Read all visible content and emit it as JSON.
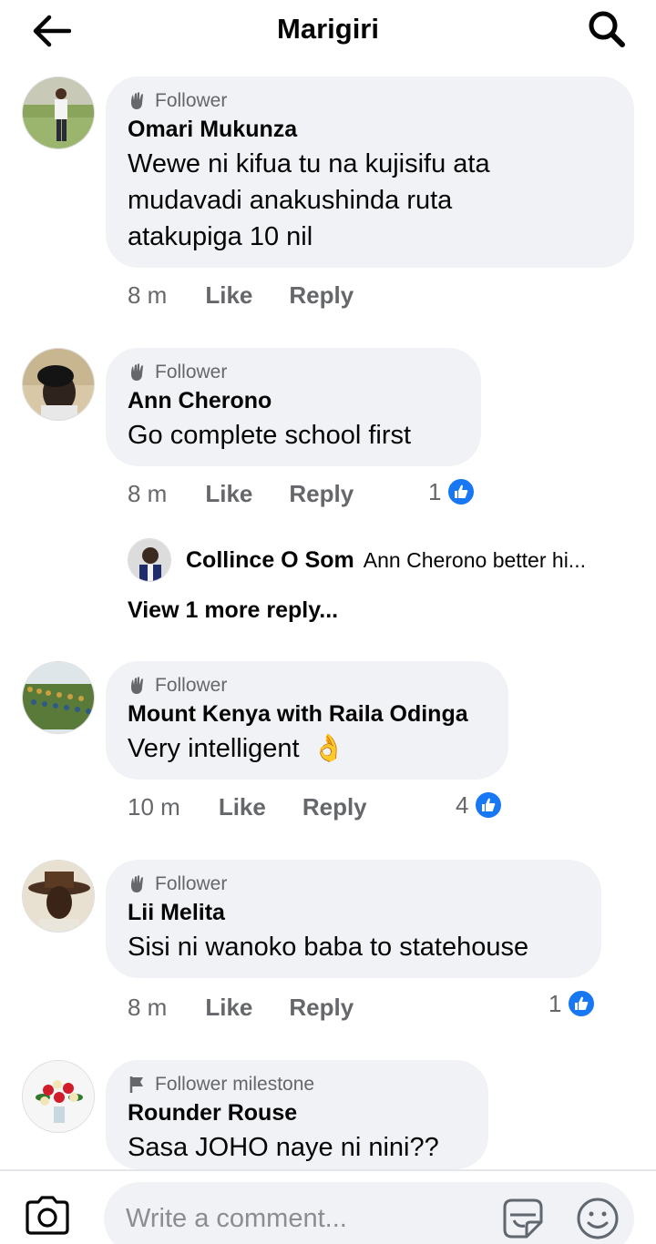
{
  "header": {
    "title": "Marigiri"
  },
  "comments": [
    {
      "badge": "Follower",
      "author": "Omari Mukunza",
      "lines": [
        " Wewe ni kifua tu na kujisifu ata",
        "mudavadi anakushinda  ruta",
        "atakupiga 10 nil"
      ],
      "time": "8 m",
      "like": "Like",
      "reply": "Reply"
    },
    {
      "badge": "Follower",
      "author": "Ann Cherono",
      "lines": [
        "Go complete school first"
      ],
      "time": "8 m",
      "like": "Like",
      "reply": "Reply",
      "reactions": "1"
    },
    {
      "badge": "Follower",
      "author": "Mount Kenya with Raila Odinga",
      "lines": [
        "Very intelligent"
      ],
      "emoji": "👌",
      "time": "10 m",
      "like": "Like",
      "reply": "Reply",
      "reactions": "4"
    },
    {
      "badge": "Follower",
      "author": "Lii Melita",
      "lines": [
        "Sisi ni wanoko baba to statehouse"
      ],
      "time": "8 m",
      "like": "Like",
      "reply": "Reply",
      "reactions": "1"
    },
    {
      "badge": "Follower milestone",
      "author": "Rounder Rouse",
      "lines": [
        "Sasa JOHO naye ni nini??"
      ]
    }
  ],
  "reply_preview": {
    "author": "Collince O Som",
    "text": "Ann Cherono better hi..."
  },
  "view_more": "View 1 more reply...",
  "composer": {
    "placeholder": "Write a comment..."
  },
  "colors": {
    "like_blue": "#1877f2",
    "bubble": "#f0f2f5",
    "meta_gray": "#65676b"
  },
  "icons": [
    "back-arrow-icon",
    "search-icon",
    "follower-hand-icon",
    "flag-icon",
    "like-thumb-icon",
    "camera-icon",
    "sticker-icon",
    "emoji-icon"
  ]
}
